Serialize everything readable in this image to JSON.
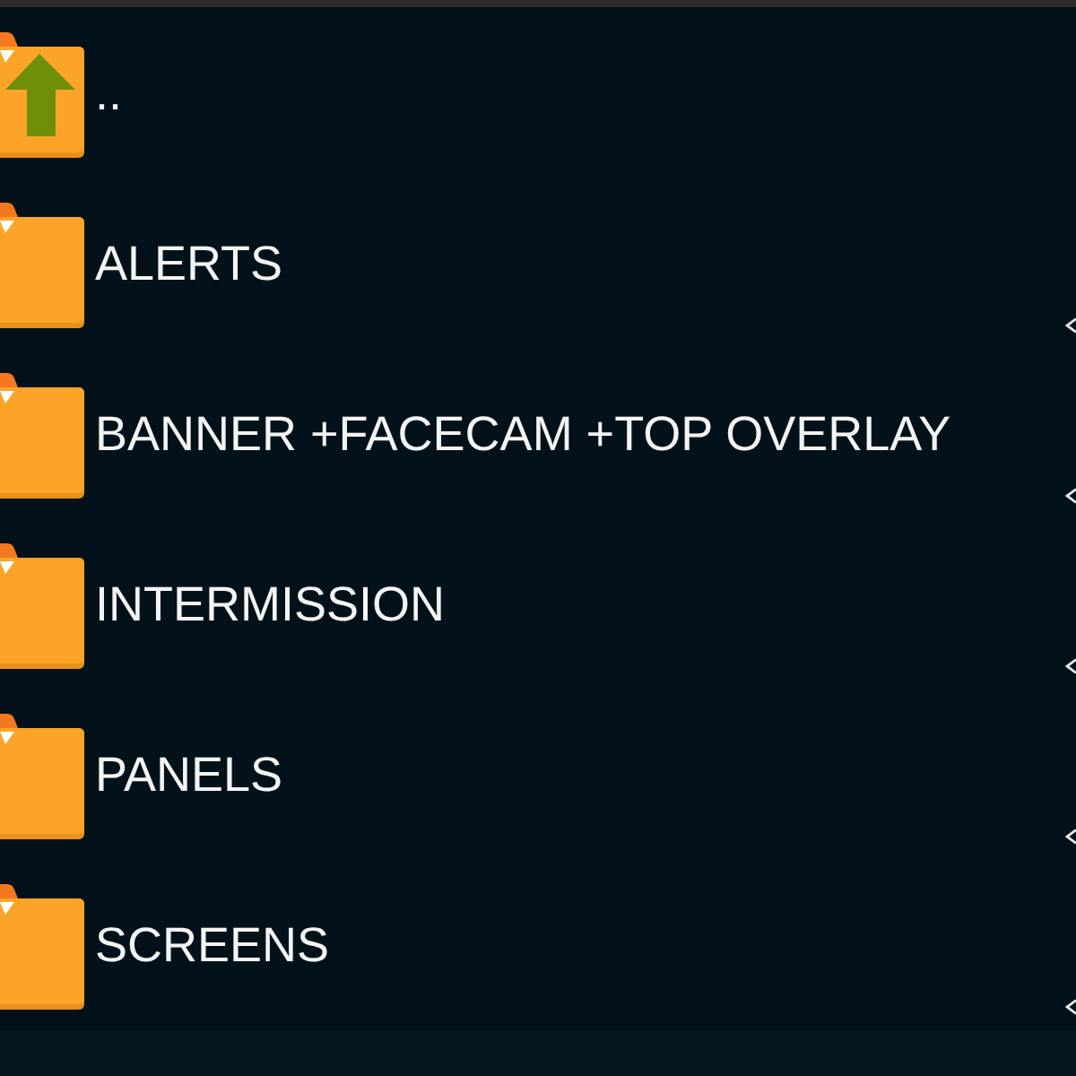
{
  "items": [
    {
      "kind": "parent",
      "label": ".."
    },
    {
      "kind": "folder",
      "label": "ALERTS"
    },
    {
      "kind": "folder",
      "label": "BANNER +FACECAM +TOP OVERLAY"
    },
    {
      "kind": "folder",
      "label": "INTERMISSION"
    },
    {
      "kind": "folder",
      "label": "PANELS"
    },
    {
      "kind": "folder",
      "label": "SCREENS"
    }
  ]
}
